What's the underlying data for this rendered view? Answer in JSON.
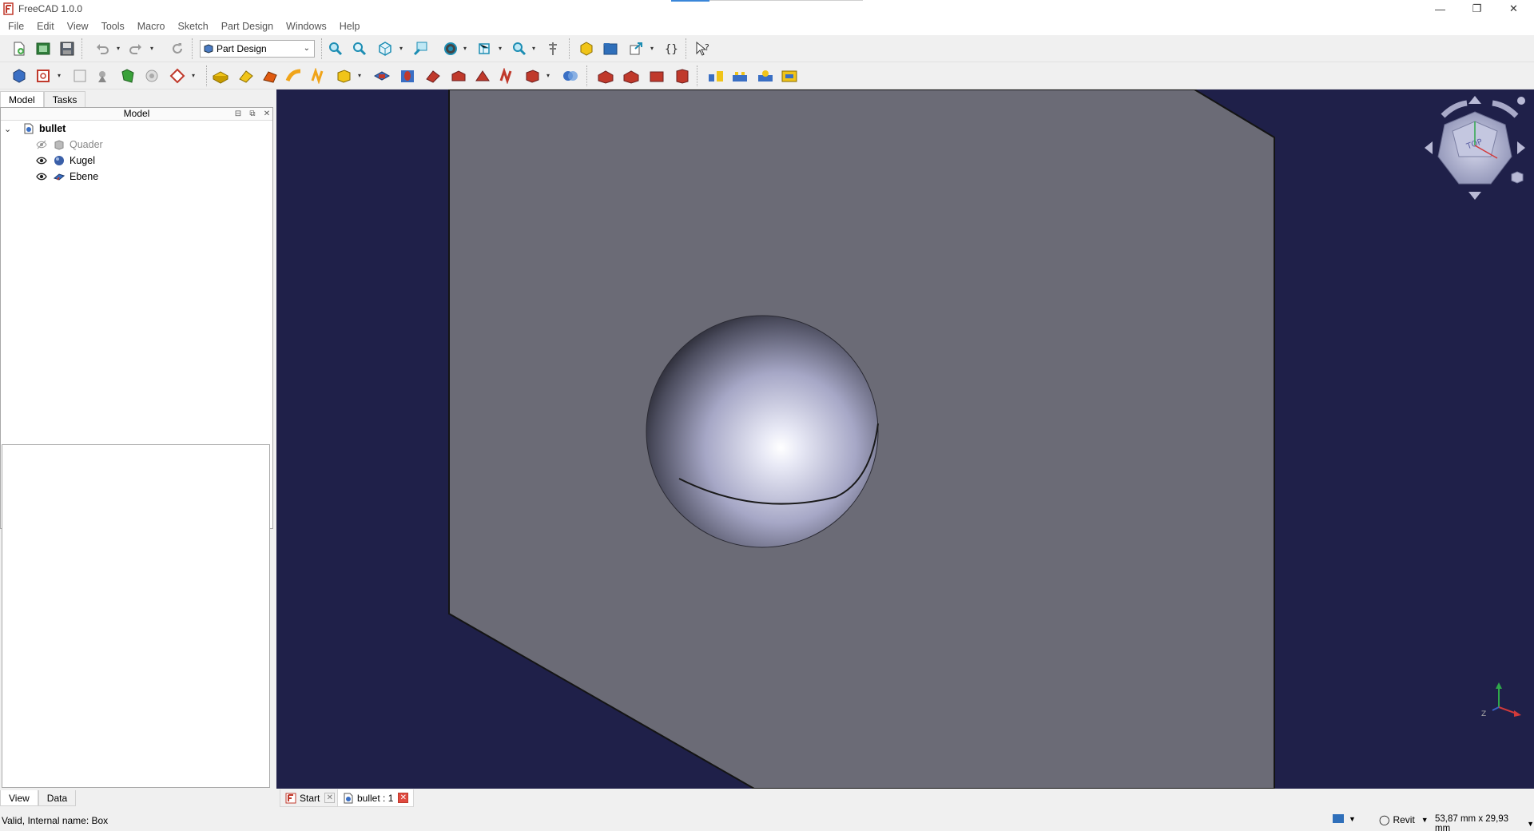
{
  "window": {
    "title": "FreeCAD 1.0.0"
  },
  "menu": [
    "File",
    "Edit",
    "View",
    "Tools",
    "Macro",
    "Sketch",
    "Part Design",
    "Windows",
    "Help"
  ],
  "toolbar": {
    "workbench": "Part Design"
  },
  "left_tabs": [
    "Model",
    "Tasks"
  ],
  "model_panel": {
    "header": "Model"
  },
  "tree": {
    "root": "bullet",
    "items": [
      {
        "label": "Quader",
        "visible": false,
        "icon": "box-icon"
      },
      {
        "label": "Kugel",
        "visible": true,
        "icon": "sphere-icon"
      },
      {
        "label": "Ebene",
        "visible": true,
        "icon": "plane-icon"
      }
    ]
  },
  "property_tabs": [
    "View",
    "Data"
  ],
  "navcube": {
    "face": "TOP"
  },
  "doc_tabs": [
    {
      "label": "Start",
      "active": false
    },
    {
      "label": "bullet : 1",
      "active": true
    }
  ],
  "status": {
    "message": "Valid, Internal name: Box",
    "nav_style": "Revit",
    "dimensions": "53,87 mm x 29,93 mm"
  },
  "colors": {
    "viewport_bg": "#1f2049",
    "plane_face": "#6b6b76",
    "accent": "#3a86d9"
  }
}
